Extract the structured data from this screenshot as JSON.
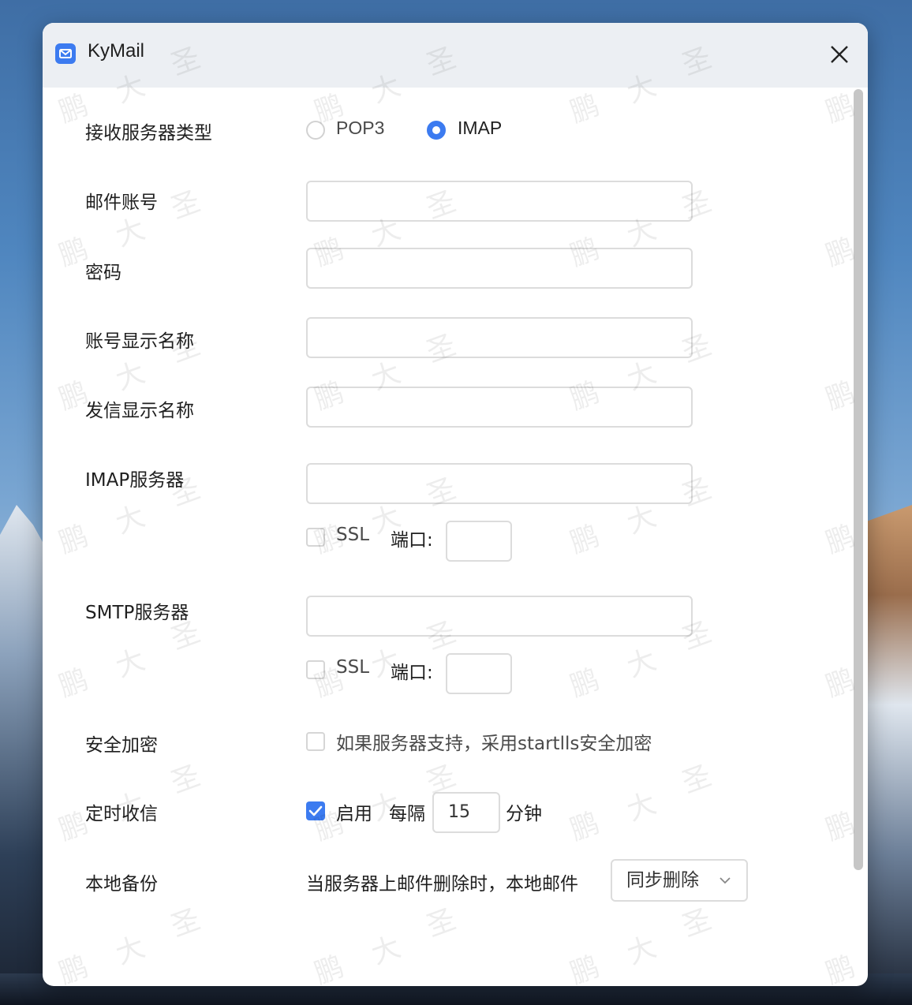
{
  "window": {
    "title": "KyMail"
  },
  "form": {
    "server_type_label": "接收服务器类型",
    "pop3_label": "POP3",
    "imap_label": "IMAP",
    "account_label": "邮件账号",
    "account_value": "",
    "password_label": "密码",
    "password_value": "",
    "display_name_label": "账号显示名称",
    "display_name_value": "",
    "sender_name_label": "发信显示名称",
    "sender_name_value": "",
    "imap_server_label": "IMAP服务器",
    "imap_server_value": "",
    "imap_ssl_label": "SSL",
    "imap_port_label": "端口:",
    "imap_port_value": "",
    "smtp_server_label": "SMTP服务器",
    "smtp_server_value": "",
    "smtp_ssl_label": "SSL",
    "smtp_port_label": "端口:",
    "smtp_port_value": "",
    "security_label": "安全加密",
    "starttls_label": "如果服务器支持，采用startlls安全加密",
    "schedule_label": "定时收信",
    "enable_label": "启用",
    "every_label": "每隔",
    "interval_value": "15",
    "minutes_label": "分钟",
    "backup_label": "本地备份",
    "backup_desc": "当服务器上邮件删除时，本地邮件",
    "backup_option": "同步删除"
  },
  "state": {
    "protocol_selected": "IMAP",
    "imap_ssl_checked": false,
    "smtp_ssl_checked": false,
    "starttls_checked": false,
    "schedule_enabled": true
  },
  "watermark": {
    "chars": [
      "鹏",
      "大",
      "圣"
    ]
  },
  "colors": {
    "accent": "#3c7bf0",
    "border": "#dcdcdc",
    "titlebar": "#eceff3"
  },
  "icons": {
    "app": "mail-icon",
    "close": "close-icon",
    "dropdown": "chevron-down-icon",
    "check": "check-icon"
  }
}
